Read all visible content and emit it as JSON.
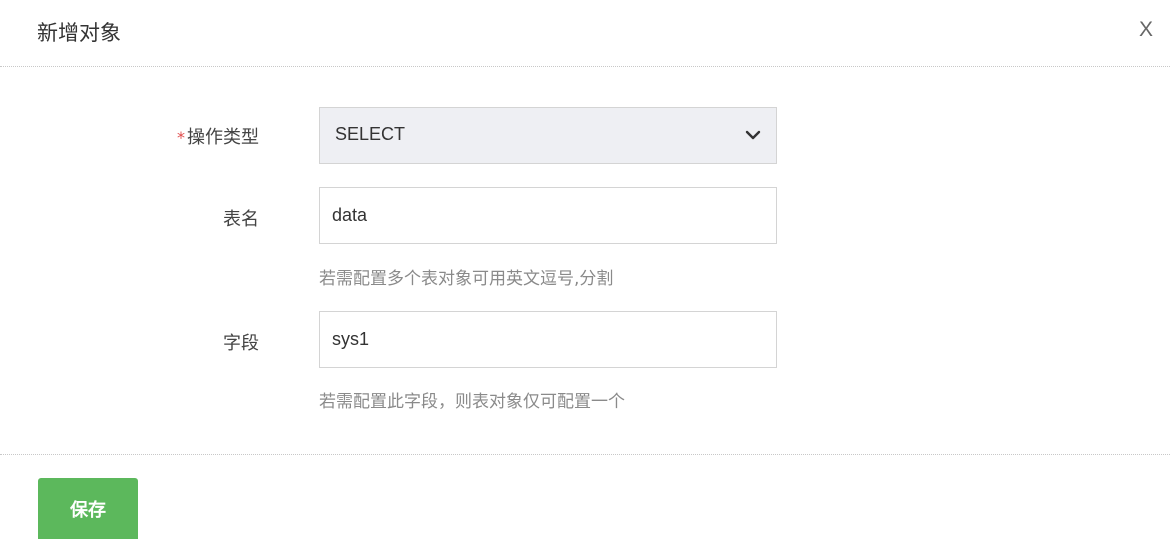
{
  "dialog": {
    "title": "新增对象",
    "close_label": "X"
  },
  "form": {
    "operation_type": {
      "required_mark": "*",
      "label": "操作类型",
      "selected_value": "SELECT",
      "icon": "chevron-down-icon"
    },
    "table_name": {
      "label": "表名",
      "value": "data",
      "hint": "若需配置多个表对象可用英文逗号,分割"
    },
    "field": {
      "label": "字段",
      "value": "sys1",
      "hint": "若需配置此字段，则表对象仅可配置一个"
    }
  },
  "footer": {
    "save_label": "保存"
  },
  "colors": {
    "required": "#e04b4b",
    "save_button": "#5cb85c",
    "select_bg": "#eeeff3",
    "hint_text": "#8a8a8a"
  }
}
